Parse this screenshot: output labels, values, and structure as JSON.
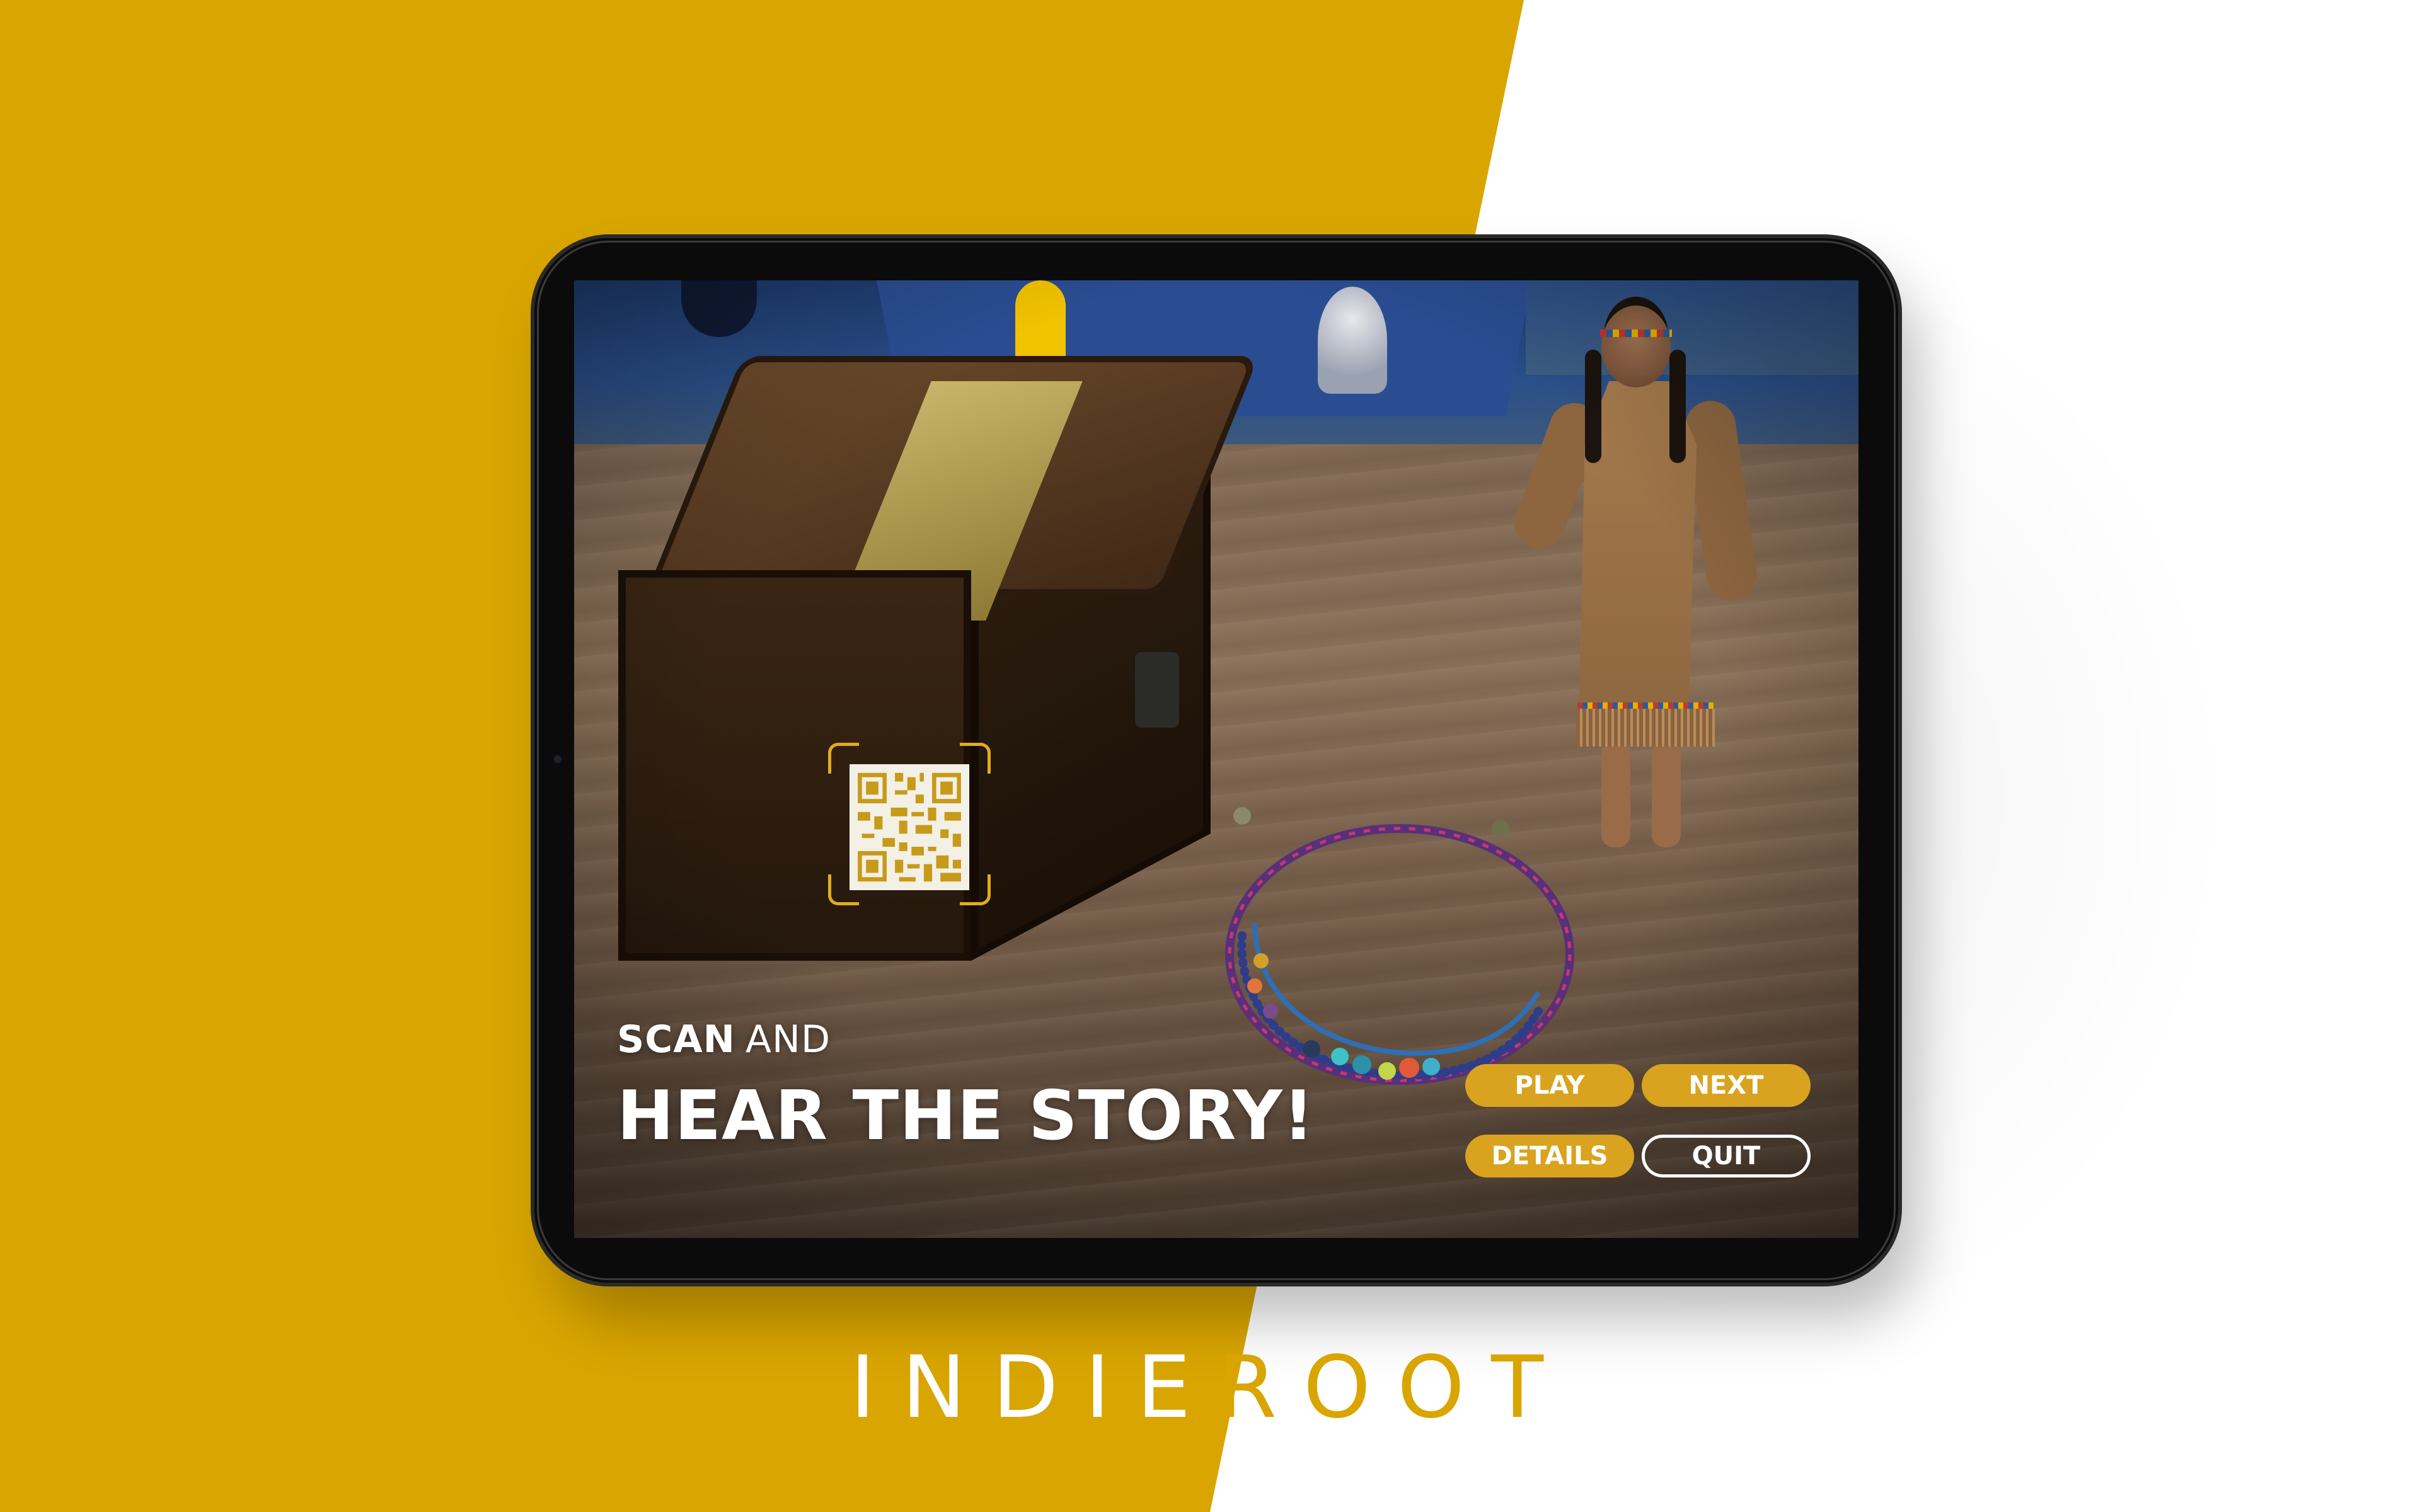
{
  "overlay": {
    "scan_strong": "SCAN",
    "scan_light": "AND",
    "headline": "HEAR THE STORY!"
  },
  "buttons": {
    "play": "PLAY",
    "next": "NEXT",
    "details": "DETAILS",
    "quit": "QUIT"
  },
  "brand": {
    "part1": "INDIE",
    "part2": "ROOT"
  },
  "colors": {
    "background_yellow": "#d9a500",
    "button_gold": "#d9a31f",
    "background_white": "#ffffff"
  }
}
